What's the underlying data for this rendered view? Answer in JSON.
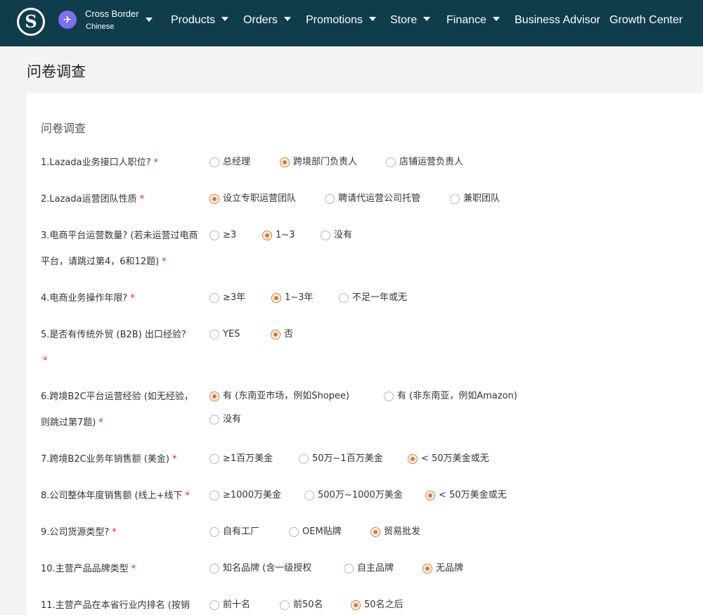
{
  "header": {
    "logo_letter": "S",
    "account_name": "Cross Border",
    "account_lang": "Chinese",
    "nav": [
      "Products",
      "Orders",
      "Promotions",
      "Store",
      "Finance",
      "Business Advisor",
      "Growth Center"
    ]
  },
  "page_title": "问卷调查",
  "form": {
    "title": "问卷调查",
    "required_mark": "*",
    "questions": [
      {
        "label": "1.Lazada业务接口人职位?",
        "options": [
          "总经理",
          "跨境部门负责人",
          "店铺运营负责人"
        ],
        "selected": 1
      },
      {
        "label": "2.Lazada运营团队性质",
        "options": [
          "设立专职运营团队",
          "聘请代运营公司托管",
          "兼职团队"
        ],
        "selected": 0
      },
      {
        "label": "3.电商平台运营数量? (若未运营过电商平台，请跳过第4，6和12题)",
        "options": [
          "≥3",
          "1~3",
          "没有"
        ],
        "selected": 1
      },
      {
        "label": "4.电商业务操作年限?",
        "options": [
          "≥3年",
          "1~3年",
          "不足一年或无"
        ],
        "selected": 1
      },
      {
        "label": "5.是否有传统外贸 (B2B) 出口经验?",
        "options": [
          "YES",
          "否"
        ],
        "selected": 1
      },
      {
        "label": "6.跨境B2C平台运营经验 (如无经验，则跳过第7题)",
        "options": [
          "有 (东南亚市场，例如Shopee)",
          "有 (非东南亚，例如Amazon)",
          "没有"
        ],
        "selected": 0
      },
      {
        "label": "7.跨境B2C业务年销售额 (美金)",
        "options": [
          "≥1百万美金",
          "50万~1百万美金",
          "< 50万美金或无"
        ],
        "selected": 2
      },
      {
        "label": "8.公司整体年度销售额 (线上+线下",
        "options": [
          "≥1000万美金",
          "500万~1000万美金",
          "< 50万美金或无"
        ],
        "selected": 2
      },
      {
        "label": "9.公司货源类型?",
        "options": [
          "自有工厂",
          "OEM贴牌",
          "贸易批发"
        ],
        "selected": 2
      },
      {
        "label": "10.主营产品品牌类型",
        "options": [
          "知名品牌 (含一级授权",
          "自主品牌",
          "无品牌"
        ],
        "selected": 2
      },
      {
        "label": "11.主营产品在本省行业内排名 (按销",
        "options": [
          "前十名",
          "前50名",
          "50名之后"
        ],
        "selected": 2
      }
    ]
  },
  "colors": {
    "nav_bg": "#0f3d4c",
    "accent": "#f36d21",
    "required": "#e2231a"
  }
}
